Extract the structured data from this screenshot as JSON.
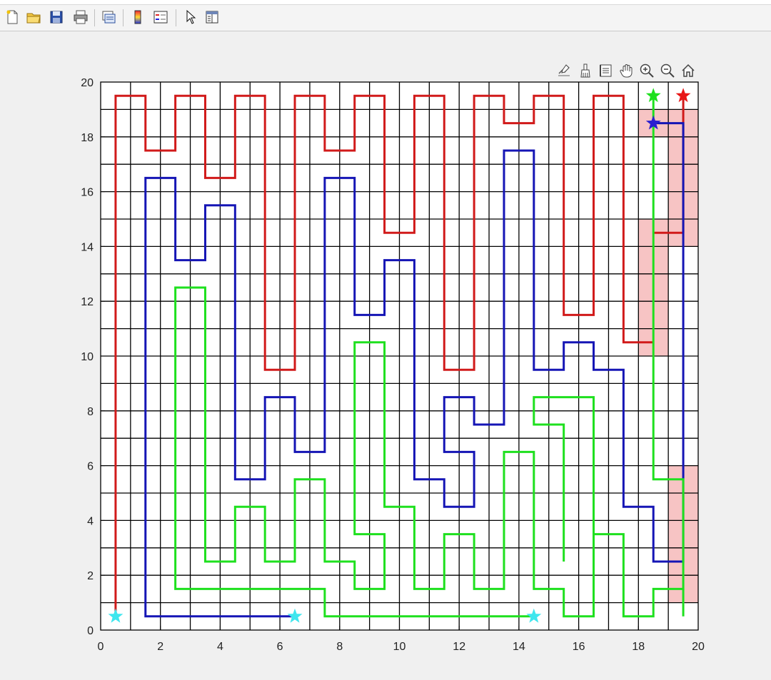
{
  "toolbar": {
    "items": [
      "new-figure-icon",
      "open-file-icon",
      "save-icon",
      "print-icon",
      "print-preview-icon",
      "colorbar-icon",
      "legend-icon",
      "edit-plot-icon",
      "property-inspector-icon"
    ]
  },
  "axes_toolbar": {
    "items": [
      "data-tips-icon",
      "brush-icon",
      "restore-view-icon",
      "pan-icon",
      "zoom-in-icon",
      "zoom-out-icon",
      "home-icon"
    ]
  },
  "chart_data": {
    "type": "line",
    "xlim": [
      0,
      20
    ],
    "ylim": [
      0,
      20
    ],
    "xticks": [
      0,
      2,
      4,
      6,
      8,
      10,
      12,
      14,
      16,
      18,
      20
    ],
    "yticks": [
      0,
      2,
      4,
      6,
      8,
      10,
      12,
      14,
      16,
      18,
      20
    ],
    "xtick_labels": [
      "0",
      "2",
      "4",
      "6",
      "8",
      "10",
      "12",
      "14",
      "16",
      "18",
      "20"
    ],
    "ytick_labels": [
      "0",
      "2",
      "4",
      "6",
      "8",
      "10",
      "12",
      "14",
      "16",
      "18",
      "20"
    ],
    "grid": true,
    "grid_step": 1,
    "highlighted_cells": [
      {
        "x": [
          18,
          19
        ],
        "y": [
          10,
          15
        ]
      },
      {
        "x": [
          18,
          20
        ],
        "y": [
          18,
          19
        ]
      },
      {
        "x": [
          19,
          20
        ],
        "y": [
          14,
          19
        ]
      },
      {
        "x": [
          19,
          20
        ],
        "y": [
          1,
          6
        ]
      }
    ],
    "highlight_color": "#f7c4c4",
    "series": [
      {
        "color": "#d11a1a",
        "points": [
          [
            0.5,
            0.5
          ],
          [
            0.5,
            19.5
          ],
          [
            1.5,
            19.5
          ],
          [
            1.5,
            17.5
          ],
          [
            2.5,
            17.5
          ],
          [
            2.5,
            19.5
          ],
          [
            3.5,
            19.5
          ],
          [
            3.5,
            16.5
          ],
          [
            4.5,
            16.5
          ],
          [
            4.5,
            19.5
          ],
          [
            5.5,
            19.5
          ],
          [
            5.5,
            9.5
          ],
          [
            6.5,
            9.5
          ],
          [
            6.5,
            19.5
          ],
          [
            7.5,
            19.5
          ],
          [
            7.5,
            17.5
          ],
          [
            8.5,
            17.5
          ],
          [
            8.5,
            19.5
          ],
          [
            9.5,
            19.5
          ],
          [
            9.5,
            14.5
          ],
          [
            10.5,
            14.5
          ],
          [
            10.5,
            19.5
          ],
          [
            11.5,
            19.5
          ],
          [
            11.5,
            9.5
          ],
          [
            12.5,
            9.5
          ],
          [
            12.5,
            19.5
          ],
          [
            13.5,
            19.5
          ],
          [
            13.5,
            18.5
          ],
          [
            14.5,
            18.5
          ],
          [
            14.5,
            19.5
          ],
          [
            15.5,
            19.5
          ],
          [
            15.5,
            11.5
          ],
          [
            16.5,
            11.5
          ],
          [
            16.5,
            19.5
          ],
          [
            17.5,
            19.5
          ],
          [
            17.5,
            10.5
          ],
          [
            18.5,
            10.5
          ]
        ],
        "extra_segments": [
          [
            [
              18.5,
              14.5
            ],
            [
              19.5,
              14.5
            ]
          ],
          [
            [
              19.5,
              14.5
            ],
            [
              19.5,
              19.5
            ]
          ]
        ]
      },
      {
        "color": "#1515b5",
        "points": [
          [
            6.5,
            0.5
          ],
          [
            1.5,
            0.5
          ],
          [
            1.5,
            16.5
          ],
          [
            2.5,
            16.5
          ],
          [
            2.5,
            13.5
          ],
          [
            3.5,
            13.5
          ],
          [
            3.5,
            15.5
          ],
          [
            4.5,
            15.5
          ],
          [
            4.5,
            5.5
          ],
          [
            5.5,
            5.5
          ],
          [
            5.5,
            8.5
          ],
          [
            6.5,
            8.5
          ],
          [
            6.5,
            6.5
          ],
          [
            7.5,
            6.5
          ],
          [
            7.5,
            16.5
          ],
          [
            8.5,
            16.5
          ],
          [
            8.5,
            11.5
          ],
          [
            9.5,
            11.5
          ],
          [
            9.5,
            13.5
          ],
          [
            10.5,
            13.5
          ],
          [
            10.5,
            5.5
          ],
          [
            11.5,
            5.5
          ],
          [
            11.5,
            4.5
          ],
          [
            12.5,
            4.5
          ],
          [
            12.5,
            6.5
          ],
          [
            11.5,
            6.5
          ],
          [
            11.5,
            8.5
          ],
          [
            12.5,
            8.5
          ],
          [
            12.5,
            7.5
          ],
          [
            13.5,
            7.5
          ],
          [
            13.5,
            17.5
          ],
          [
            14.5,
            17.5
          ],
          [
            14.5,
            9.5
          ],
          [
            15.5,
            9.5
          ],
          [
            15.5,
            10.5
          ],
          [
            16.5,
            10.5
          ],
          [
            16.5,
            9.5
          ],
          [
            17.5,
            9.5
          ],
          [
            17.5,
            4.5
          ],
          [
            18.5,
            4.5
          ],
          [
            18.5,
            2.5
          ],
          [
            19.5,
            2.5
          ],
          [
            19.5,
            18.5
          ],
          [
            18.5,
            18.5
          ]
        ]
      },
      {
        "color": "#1ee01e",
        "points": [
          [
            14.5,
            0.5
          ],
          [
            7.5,
            0.5
          ],
          [
            7.5,
            1.5
          ],
          [
            2.5,
            1.5
          ],
          [
            2.5,
            12.5
          ],
          [
            3.5,
            12.5
          ],
          [
            3.5,
            2.5
          ],
          [
            4.5,
            2.5
          ],
          [
            4.5,
            4.5
          ],
          [
            5.5,
            4.5
          ],
          [
            5.5,
            2.5
          ],
          [
            6.5,
            2.5
          ],
          [
            6.5,
            5.5
          ],
          [
            7.5,
            5.5
          ],
          [
            7.5,
            2.5
          ],
          [
            8.5,
            2.5
          ],
          [
            8.5,
            1.5
          ],
          [
            9.5,
            1.5
          ],
          [
            9.5,
            3.5
          ],
          [
            8.5,
            3.5
          ],
          [
            8.5,
            10.5
          ],
          [
            9.5,
            10.5
          ],
          [
            9.5,
            4.5
          ],
          [
            10.5,
            4.5
          ],
          [
            10.5,
            1.5
          ],
          [
            11.5,
            1.5
          ],
          [
            11.5,
            3.5
          ],
          [
            12.5,
            3.5
          ],
          [
            12.5,
            1.5
          ],
          [
            13.5,
            1.5
          ],
          [
            13.5,
            6.5
          ],
          [
            14.5,
            6.5
          ],
          [
            14.5,
            1.5
          ],
          [
            15.5,
            1.5
          ],
          [
            15.5,
            0.5
          ],
          [
            16.5,
            0.5
          ],
          [
            16.5,
            3.5
          ],
          [
            17.5,
            3.5
          ],
          [
            17.5,
            0.5
          ],
          [
            18.5,
            0.5
          ],
          [
            18.5,
            1.5
          ],
          [
            19.5,
            1.5
          ],
          [
            19.5,
            5.5
          ],
          [
            18.5,
            5.5
          ],
          [
            18.5,
            19.5
          ]
        ],
        "extra_segments": [
          [
            [
              19.5,
              1.5
            ],
            [
              19.5,
              0.5
            ]
          ],
          [
            [
              15.5,
              2.5
            ],
            [
              15.5,
              7.5
            ],
            [
              14.5,
              7.5
            ],
            [
              14.5,
              8.5
            ],
            [
              16.5,
              8.5
            ],
            [
              16.5,
              3.5
            ]
          ]
        ]
      }
    ],
    "markers": [
      {
        "x": 0.5,
        "y": 0.5,
        "color": "#3ee6ee",
        "shape": "star"
      },
      {
        "x": 6.5,
        "y": 0.5,
        "color": "#3ee6ee",
        "shape": "star"
      },
      {
        "x": 14.5,
        "y": 0.5,
        "color": "#3ee6ee",
        "shape": "star"
      },
      {
        "x": 18.5,
        "y": 19.5,
        "color": "#1ee01e",
        "shape": "star"
      },
      {
        "x": 19.5,
        "y": 19.5,
        "color": "#e81616",
        "shape": "star"
      },
      {
        "x": 18.5,
        "y": 18.5,
        "color": "#2b1fd0",
        "shape": "star"
      }
    ]
  }
}
